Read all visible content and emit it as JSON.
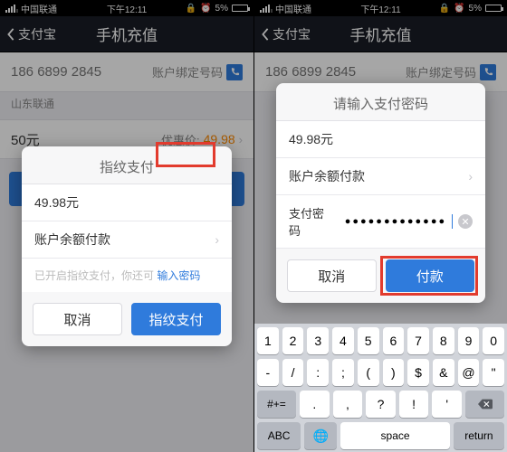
{
  "status": {
    "carrier": "中国联通",
    "signal": "●●●●○",
    "time": "下午12:11",
    "lock": "🔒",
    "alarm": "⏰",
    "battery": "5%"
  },
  "nav": {
    "back": "支付宝",
    "title": "手机充值"
  },
  "page": {
    "phone": "186 6899 2845",
    "bound_label": "账户绑定号码",
    "carrier": "山东联通",
    "amount": "50元",
    "discount_label": "优惠价:",
    "discount_price": "49.98"
  },
  "modal_left": {
    "title": "指纹支付",
    "price": "49.98元",
    "method": "账户余额付款",
    "tip_prefix": "已开启指纹支付，你还可",
    "tip_link": "输入密码",
    "cancel": "取消",
    "confirm": "指纹支付"
  },
  "modal_right": {
    "title": "请输入支付密码",
    "price": "49.98元",
    "method": "账户余额付款",
    "pw_label": "支付密码",
    "pw_mask": "●●●●●●●●●●●●●",
    "cancel": "取消",
    "confirm": "付款"
  },
  "keyboard": {
    "r1": [
      "1",
      "2",
      "3",
      "4",
      "5",
      "6",
      "7",
      "8",
      "9",
      "0"
    ],
    "r2": [
      "-",
      "/",
      ":",
      ";",
      "(",
      ")",
      "$",
      "&",
      "@",
      "\""
    ],
    "r3": [
      ".",
      ",",
      "?",
      "!",
      "'"
    ],
    "sym": "#+=",
    "abc": "ABC",
    "space": "space",
    "ret": "return"
  }
}
